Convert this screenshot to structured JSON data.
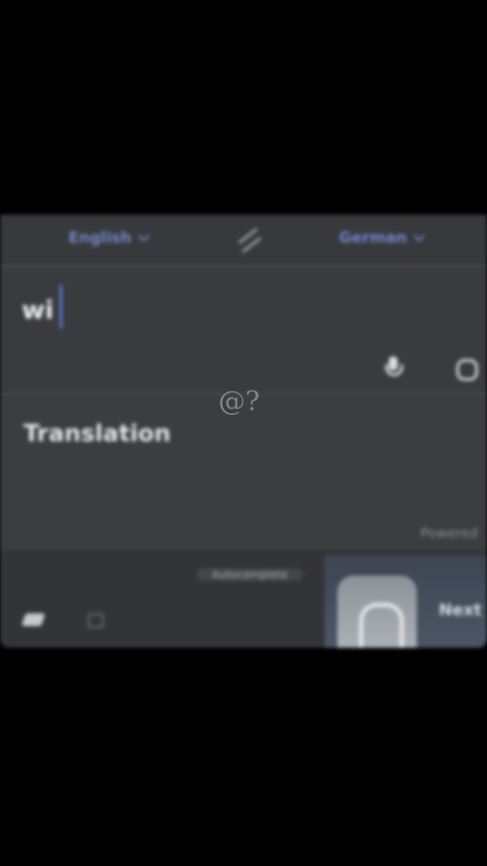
{
  "language_bar": {
    "source_language": "English",
    "target_language": "German",
    "swap_icon": "swap-arrows-icon"
  },
  "input": {
    "text": "wi",
    "tools": {
      "mic_icon": "microphone-icon",
      "camera_icon": "camera-icon"
    }
  },
  "output": {
    "text": "Translation",
    "more_label": "Powered"
  },
  "bottom_bar": {
    "suggestion": "Autocomplete",
    "next_key_label": "Next"
  },
  "watermark": "@?",
  "colors": {
    "background": "#000000",
    "panel": "#3b3c3f",
    "accent": "#6f86c8",
    "cursor": "#5a7bd8"
  }
}
